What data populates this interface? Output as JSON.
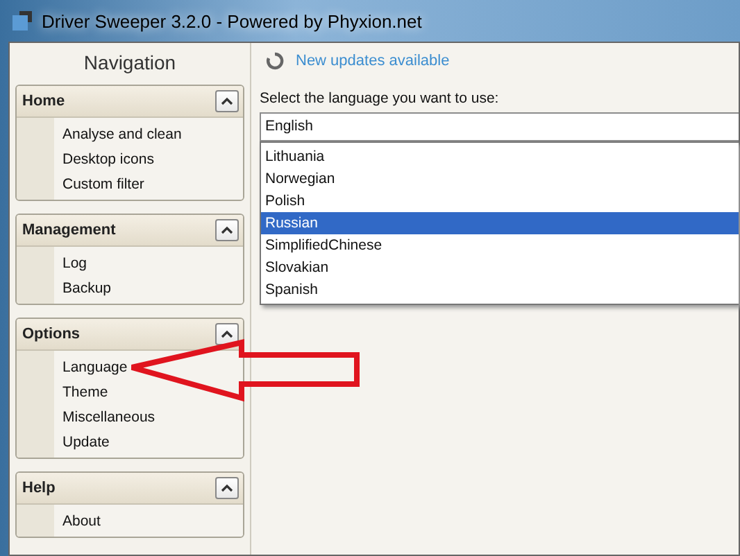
{
  "window": {
    "title": "Driver Sweeper 3.2.0 - Powered by Phyxion.net"
  },
  "navigation": {
    "title": "Navigation",
    "groups": [
      {
        "title": "Home",
        "expanded": true,
        "items": [
          "Analyse and clean",
          "Desktop icons",
          "Custom filter"
        ]
      },
      {
        "title": "Management",
        "expanded": true,
        "items": [
          "Log",
          "Backup"
        ]
      },
      {
        "title": "Options",
        "expanded": true,
        "items": [
          "Language",
          "Theme",
          "Miscellaneous",
          "Update"
        ]
      },
      {
        "title": "Help",
        "expanded": true,
        "items": [
          "About"
        ]
      }
    ]
  },
  "update_notice": "New updates available",
  "language": {
    "label": "Select the language you want to use:",
    "value": "English",
    "options": [
      {
        "label": "Lithuania",
        "selected": false
      },
      {
        "label": "Norwegian",
        "selected": false
      },
      {
        "label": "Polish",
        "selected": false
      },
      {
        "label": "Russian",
        "selected": true
      },
      {
        "label": "SimplifiedChinese",
        "selected": false
      },
      {
        "label": "Slovakian",
        "selected": false
      },
      {
        "label": "Spanish",
        "selected": false
      }
    ]
  }
}
